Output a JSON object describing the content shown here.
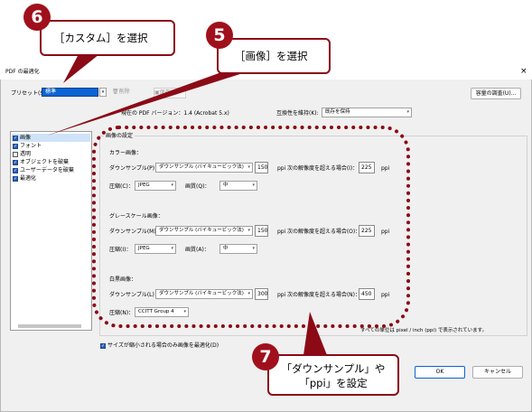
{
  "dialog": {
    "title": "PDF の最適化",
    "close": "×",
    "preset_label": "プリセット(S):",
    "preset_value": "標準",
    "delete_label": "削除",
    "save_label": "保存",
    "audit_button": "容量の調査(U)...",
    "pdf_version": "現在の PDF バージョン：1.4 (Acrobat 5.x)",
    "compat_label": "互換性を維持(K):",
    "compat_value": "既存を保持"
  },
  "sidebar": {
    "items": [
      {
        "label": "画像",
        "checked": true
      },
      {
        "label": "フォント",
        "checked": true
      },
      {
        "label": "透明",
        "checked": false
      },
      {
        "label": "オブジェクトを破棄",
        "checked": true
      },
      {
        "label": "ユーザーデータを破棄",
        "checked": true
      },
      {
        "label": "最適化",
        "checked": true
      }
    ]
  },
  "settings": {
    "group_title": "画像の設定",
    "color": {
      "title": "カラー画像：",
      "downsample_label": "ダウンサンプル(P)：",
      "downsample_value": "ダウンサンプル (バイキュービック法)",
      "ppi_value": "150",
      "ppi_unit": "ppi",
      "above_label": "次の解像度を超える場合(I)：",
      "above_value": "225",
      "compress_label": "圧縮(C)：",
      "compress_value": "JPEG",
      "quality_label": "画質(Q)：",
      "quality_value": "中"
    },
    "gray": {
      "title": "グレースケール画像：",
      "downsample_label": "ダウンサンプル(M)：",
      "downsample_value": "ダウンサンプル (バイキュービック法)",
      "ppi_value": "150",
      "ppi_unit": "ppi",
      "above_label": "次の解像度を超える場合(O)：",
      "above_value": "225",
      "compress_label": "圧縮(I)：",
      "compress_value": "JPEG",
      "quality_label": "画質(A)：",
      "quality_value": "中"
    },
    "mono": {
      "title": "白黒画像：",
      "downsample_label": "ダウンサンプル(L)：",
      "downsample_value": "ダウンサンプル (バイキュービック法)",
      "ppi_value": "300",
      "ppi_unit": "ppi",
      "above_label": "次の解像度を超える場合(N)：",
      "above_value": "450",
      "compress_label": "圧縮(N)：",
      "compress_value": "CCITT Group 4"
    },
    "unit_note": "すべての単位は pixel / inch (ppi) で表示されています。",
    "smaller_only": "サイズが縮小される場合のみ画像を最適化(D)"
  },
  "buttons": {
    "ok": "OK",
    "cancel": "キャンセル"
  },
  "callouts": {
    "c6": {
      "number": "6",
      "text": "［カスタム］を選択"
    },
    "c5": {
      "number": "5",
      "text": "［画像］を選択"
    },
    "c7": {
      "number": "7",
      "line1": "「ダウンサンプル」や",
      "line2": "「ppi」を設定"
    }
  },
  "colors": {
    "accent": "#8b0a16",
    "circle": "#a0101c",
    "selection": "#0a64d4"
  }
}
